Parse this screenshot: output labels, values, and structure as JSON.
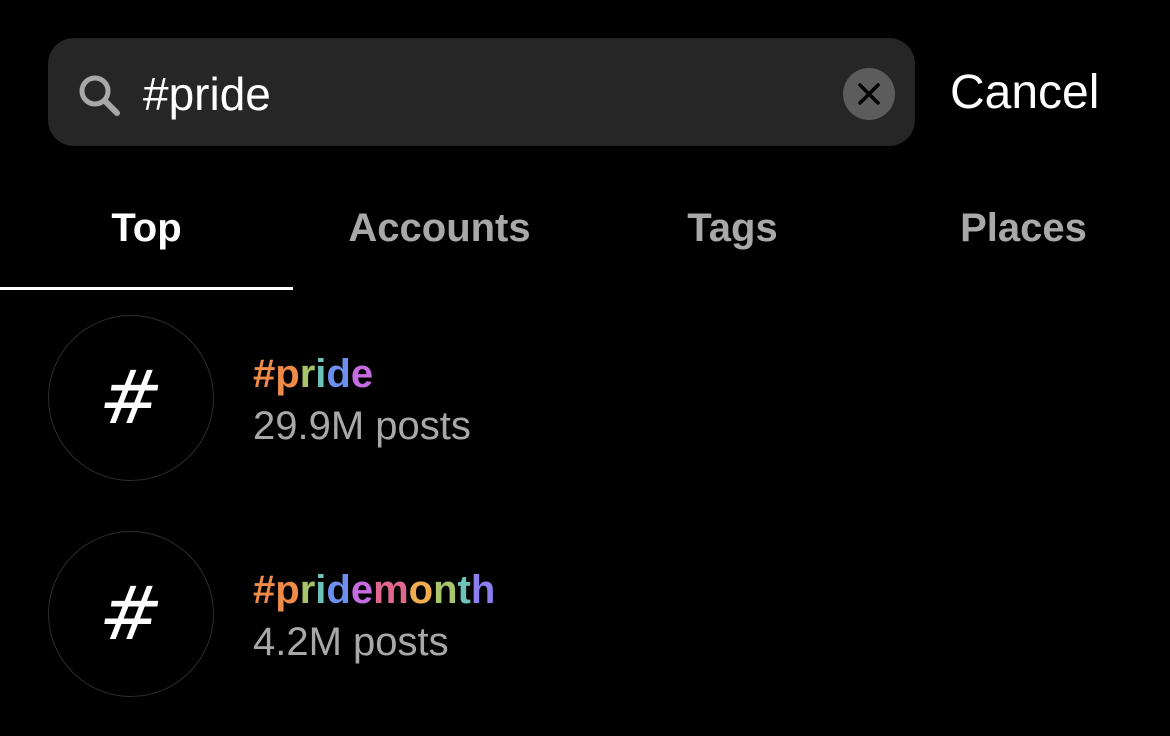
{
  "search": {
    "query": "#pride",
    "cancel_label": "Cancel"
  },
  "tabs": [
    {
      "label": "Top",
      "active": true
    },
    {
      "label": "Accounts",
      "active": false
    },
    {
      "label": "Tags",
      "active": false
    },
    {
      "label": "Places",
      "active": false
    }
  ],
  "results": [
    {
      "avatar_symbol": "#",
      "name": "#pride",
      "meta": "29.9M posts"
    },
    {
      "avatar_symbol": "#",
      "name": "#pridemonth",
      "meta": "4.2M posts"
    }
  ],
  "rainbow_colors": [
    "#f08a49",
    "#f08a49",
    "#a9c46a",
    "#6cc3b9",
    "#6c8ff0",
    "#c46ce0",
    "#e0688e",
    "#f0ae4f",
    "#a9c46a",
    "#6cc3b9",
    "#8a7ef0"
  ],
  "colors": {
    "background": "#000000",
    "search_bar": "#262626",
    "secondary_text": "#a8a8a8",
    "clear_button": "#5c5c5c"
  },
  "icons": {
    "search": "search-icon",
    "clear": "close-icon"
  }
}
